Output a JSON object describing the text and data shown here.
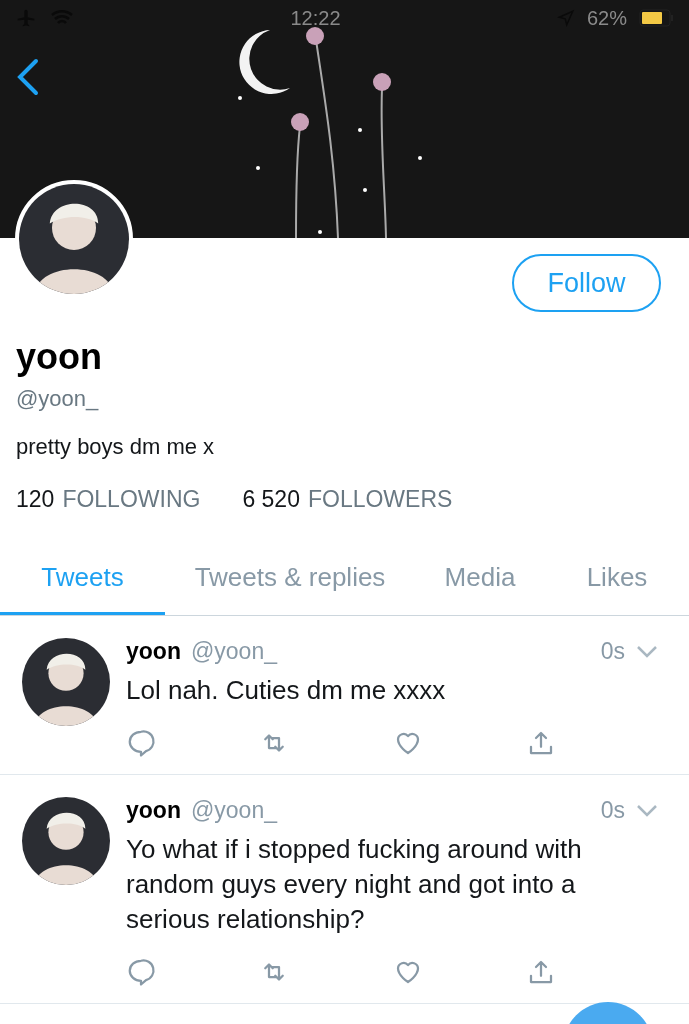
{
  "status_bar": {
    "time": "12:22",
    "battery": "62%"
  },
  "profile": {
    "name": "yoon",
    "handle": "@yoon_",
    "bio": "pretty boys dm me x",
    "follow_button": "Follow",
    "following_count": "120",
    "following_label": "FOLLOWING",
    "followers_count": "6 520",
    "followers_label": "FOLLOWERS"
  },
  "tabs": [
    {
      "label": "Tweets",
      "selected": true
    },
    {
      "label": "Tweets & replies",
      "selected": false
    },
    {
      "label": "Media",
      "selected": false
    },
    {
      "label": "Likes",
      "selected": false
    }
  ],
  "tweets": [
    {
      "name": "yoon",
      "handle": "@yoon_",
      "time": "0s",
      "text": "Lol nah. Cuties dm me xxxx"
    },
    {
      "name": "yoon",
      "handle": "@yoon_",
      "time": "0s",
      "text": "Yo what if i stopped fucking around with random guys every night and got into a serious relationship?"
    }
  ]
}
